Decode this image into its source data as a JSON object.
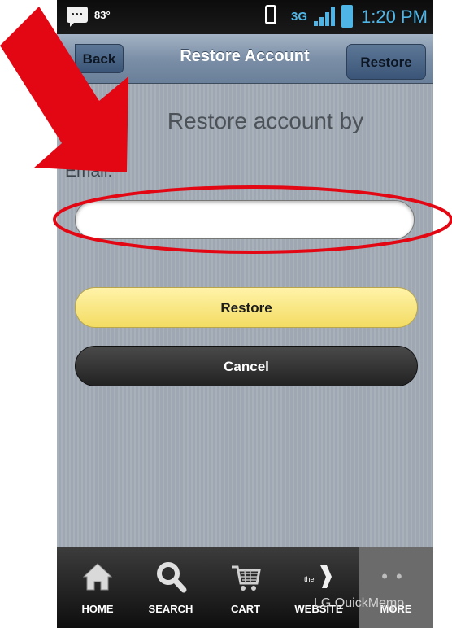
{
  "status_bar": {
    "temperature": "83°",
    "network": "3G",
    "time": "1:20 PM"
  },
  "header": {
    "back_label": "Back",
    "title": "Restore Account",
    "restore_label": "Restore"
  },
  "form": {
    "heading": "Restore account by",
    "email_label": "Email:",
    "email_value": ""
  },
  "buttons": {
    "restore_label": "Restore",
    "cancel_label": "Cancel"
  },
  "tabs": [
    {
      "label": "HOME",
      "icon": "home-icon"
    },
    {
      "label": "SEARCH",
      "icon": "search-icon"
    },
    {
      "label": "CART",
      "icon": "cart-icon"
    },
    {
      "label": "WEBSITE",
      "icon": "ymca-logo-icon"
    },
    {
      "label": "MORE",
      "icon": "more-icon"
    }
  ],
  "watermark": "LG QuickMemo",
  "colors": {
    "annotation_red": "#e30613",
    "header_blue": "#7b8fa7",
    "restore_yellow": "#f3dc63",
    "cancel_dark": "#2a2a2a",
    "status_blue": "#4fb5e6"
  }
}
